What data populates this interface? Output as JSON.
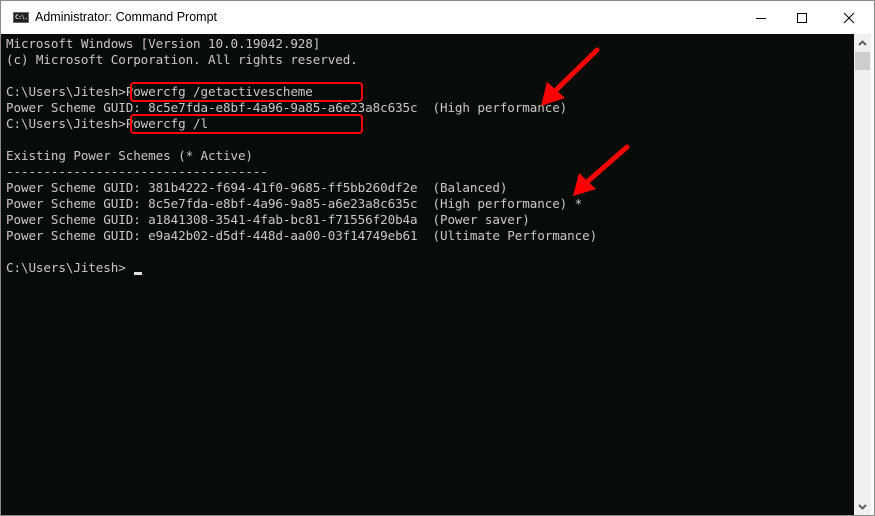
{
  "window": {
    "title": "Administrator: Command Prompt",
    "icon": "cmd-icon",
    "icon_text": "C:\\.",
    "controls": {
      "minimize": "minimize-icon",
      "maximize": "maximize-icon",
      "close": "close-icon"
    }
  },
  "console": {
    "lines": [
      "Microsoft Windows [Version 10.0.19042.928]",
      "(c) Microsoft Corporation. All rights reserved.",
      "",
      "C:\\Users\\Jitesh>Powercfg /getactivescheme",
      "Power Scheme GUID: 8c5e7fda-e8bf-4a96-9a85-a6e23a8c635c  (High performance)",
      "C:\\Users\\Jitesh>Powercfg /l",
      "",
      "Existing Power Schemes (* Active)",
      "-----------------------------------",
      "Power Scheme GUID: 381b4222-f694-41f0-9685-ff5bb260df2e  (Balanced)",
      "Power Scheme GUID: 8c5e7fda-e8bf-4a96-9a85-a6e23a8c635c  (High performance) *",
      "Power Scheme GUID: a1841308-3541-4fab-bc81-f71556f20b4a  (Power saver)",
      "Power Scheme GUID: e9a42b02-d5df-448d-aa00-03f14749eb61  (Ultimate Performance)",
      "",
      "C:\\Users\\Jitesh>"
    ],
    "highlighted_commands": [
      "Powercfg /getactivescheme",
      "Powercfg /l"
    ],
    "annotation_color": "#ff0000",
    "text_color": "#c8c8c8",
    "background_color": "#080c08"
  },
  "scrollbar": {
    "up": "chevron-up-icon",
    "down": "chevron-down-icon"
  }
}
